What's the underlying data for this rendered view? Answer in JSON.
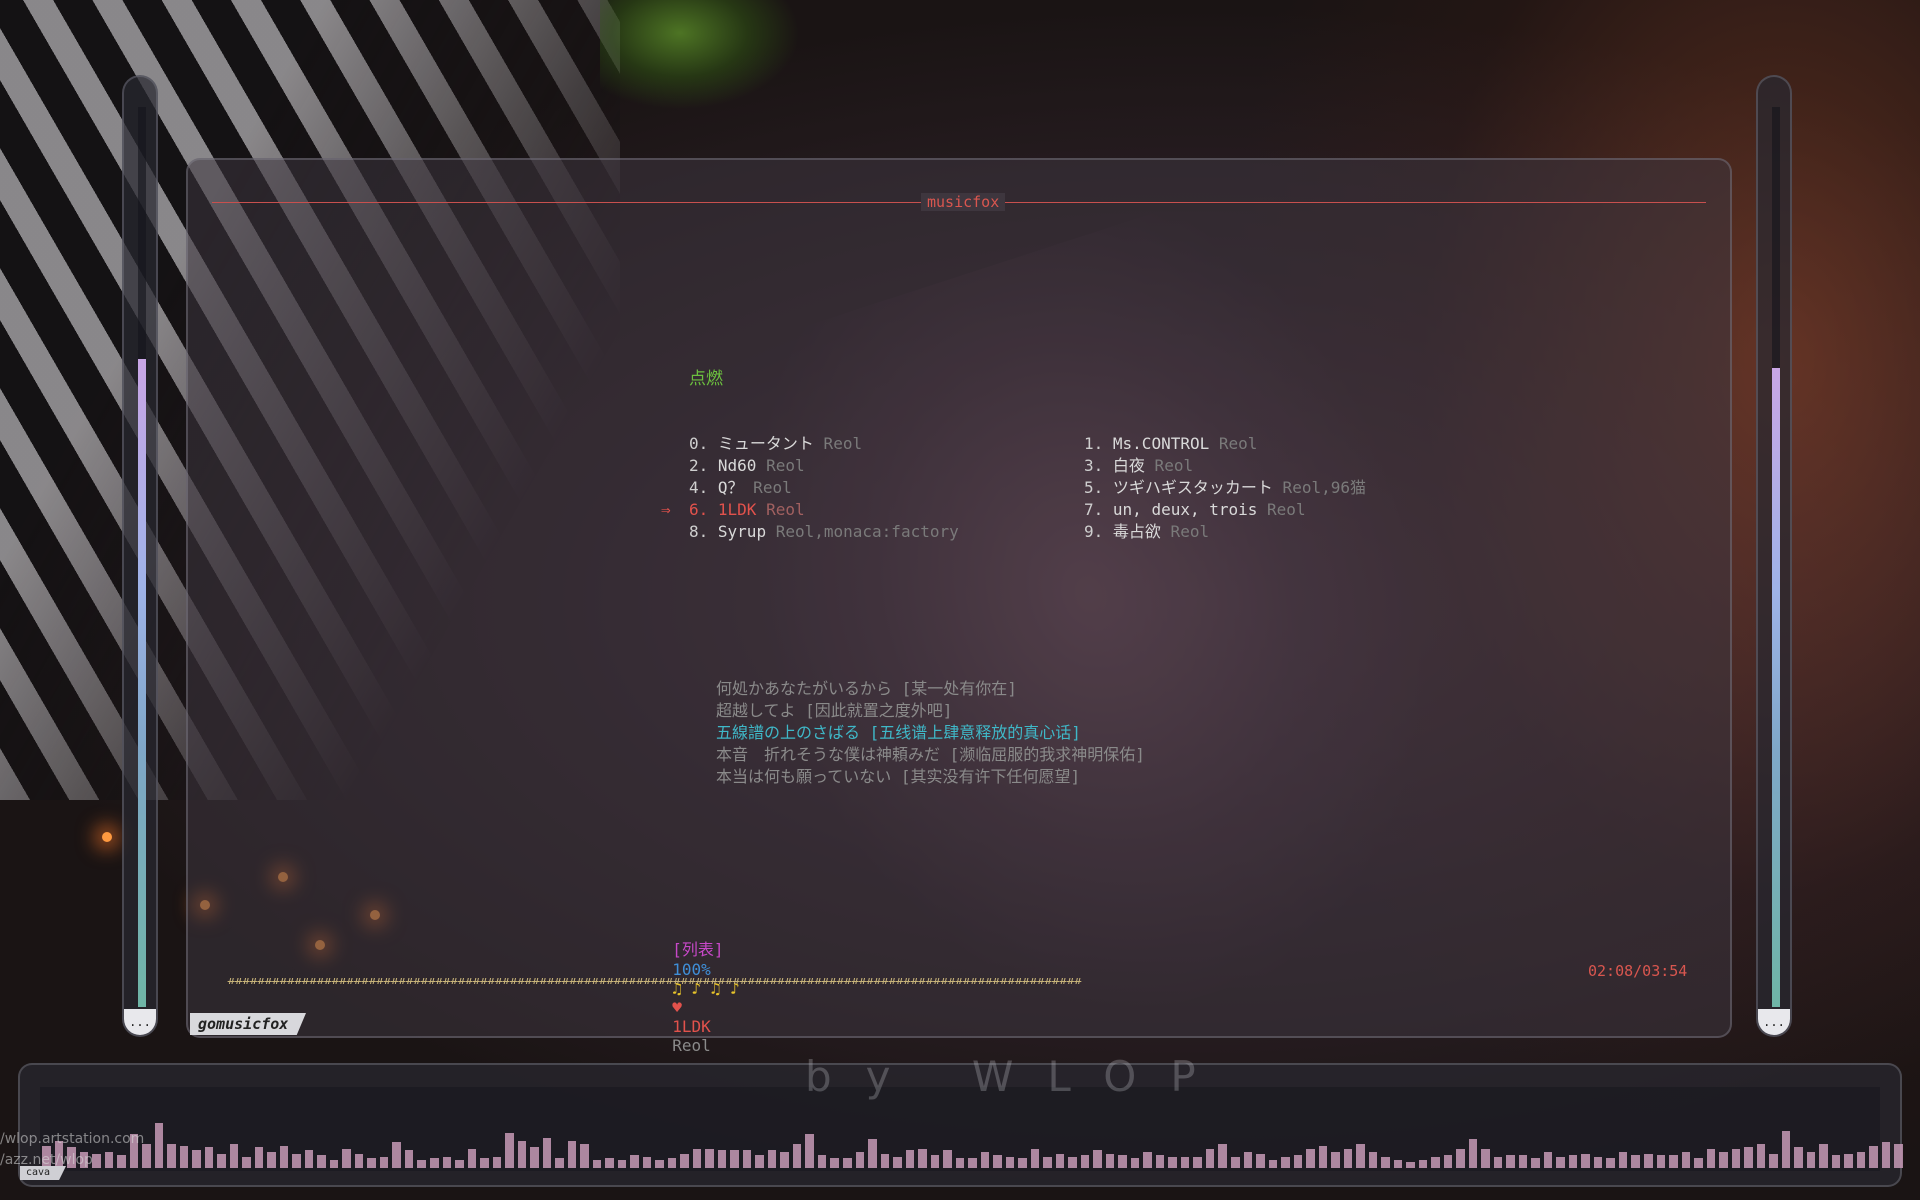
{
  "window": {
    "title": "musicfox",
    "tab_label": "gomusicfox"
  },
  "menu": {
    "title": "点燃",
    "selected_index": 6,
    "left": [
      {
        "num": "0.",
        "name": "ミュータント",
        "artist": "Reol"
      },
      {
        "num": "2.",
        "name": "Nd60",
        "artist": "Reol"
      },
      {
        "num": "4.",
        "name": "Q？",
        "artist": "Reol"
      },
      {
        "num": "6.",
        "name": "1LDK",
        "artist": "Reol"
      },
      {
        "num": "8.",
        "name": "Syrup",
        "artist": "Reol,monaca:factory"
      }
    ],
    "right": [
      {
        "num": "1.",
        "name": "Ms.CONTROL",
        "artist": "Reol"
      },
      {
        "num": "3.",
        "name": "白夜",
        "artist": "Reol"
      },
      {
        "num": "5.",
        "name": "ツギハギスタッカート",
        "artist": "Reol,96猫"
      },
      {
        "num": "7.",
        "name": "un, deux, trois",
        "artist": "Reol"
      },
      {
        "num": "9.",
        "name": "毒占欲",
        "artist": "Reol"
      }
    ],
    "cursor_symbol": "⇒"
  },
  "lyrics": [
    {
      "text": "何処かあなたがいるから [某一处有你在]",
      "active": false
    },
    {
      "text": "超越してよ [因此就置之度外吧]",
      "active": false
    },
    {
      "text": "五線譜の上のさばる [五线谱上肆意释放的真心话]",
      "active": true
    },
    {
      "text": "本音　折れそうな僕は神頼みだ [濒临屈服的我求神明保佑]",
      "active": false
    },
    {
      "text": "本当は何も願っていない [其实没有许下任何愿望]",
      "active": false
    }
  ],
  "status": {
    "mode": "[列表]",
    "volume": "100%",
    "notes": "♫ ♪ ♫ ♪",
    "heart": "♥",
    "song": "1LDK",
    "artist": "Reol"
  },
  "progress": {
    "elapsed": "02:08",
    "total": "03:54",
    "time_text": "02:08/03:54",
    "fraction": 0.547
  },
  "visualizer": {
    "label": "cava",
    "watermark": "by WLOP",
    "bar_color": "#c79ab6",
    "levels": [
      0.28,
      0.34,
      0.26,
      0.2,
      0.18,
      0.2,
      0.16,
      0.42,
      0.3,
      0.56,
      0.3,
      0.28,
      0.22,
      0.26,
      0.18,
      0.3,
      0.14,
      0.26,
      0.2,
      0.28,
      0.18,
      0.22,
      0.16,
      0.1,
      0.24,
      0.18,
      0.12,
      0.14,
      0.32,
      0.22,
      0.1,
      0.12,
      0.14,
      0.1,
      0.24,
      0.12,
      0.14,
      0.44,
      0.34,
      0.26,
      0.38,
      0.12,
      0.34,
      0.3,
      0.1,
      0.12,
      0.1,
      0.16,
      0.14,
      0.1,
      0.12,
      0.18,
      0.24,
      0.24,
      0.22,
      0.22,
      0.22,
      0.16,
      0.22,
      0.2,
      0.3,
      0.42,
      0.16,
      0.12,
      0.12,
      0.2,
      0.36,
      0.18,
      0.14,
      0.22,
      0.24,
      0.16,
      0.22,
      0.12,
      0.12,
      0.2,
      0.16,
      0.14,
      0.12,
      0.24,
      0.14,
      0.18,
      0.14,
      0.16,
      0.22,
      0.18,
      0.16,
      0.12,
      0.2,
      0.16,
      0.14,
      0.14,
      0.14,
      0.24,
      0.3,
      0.14,
      0.2,
      0.18,
      0.1,
      0.14,
      0.16,
      0.24,
      0.28,
      0.2,
      0.24,
      0.3,
      0.2,
      0.14,
      0.1,
      0.08,
      0.1,
      0.14,
      0.16,
      0.24,
      0.36,
      0.24,
      0.14,
      0.16,
      0.16,
      0.12,
      0.2,
      0.14,
      0.16,
      0.18,
      0.14,
      0.12,
      0.2,
      0.16,
      0.18,
      0.16,
      0.16,
      0.2,
      0.12,
      0.24,
      0.2,
      0.24,
      0.26,
      0.3,
      0.18,
      0.46,
      0.26,
      0.2,
      0.3,
      0.16,
      0.18,
      0.2,
      0.28,
      0.32,
      0.3
    ]
  },
  "side_bars": {
    "left_level": 0.72,
    "right_level": 0.71,
    "button_label": "..."
  },
  "credits": {
    "line1": "/wlop.artstation.com",
    "line2": "/azz.net/wlop"
  }
}
